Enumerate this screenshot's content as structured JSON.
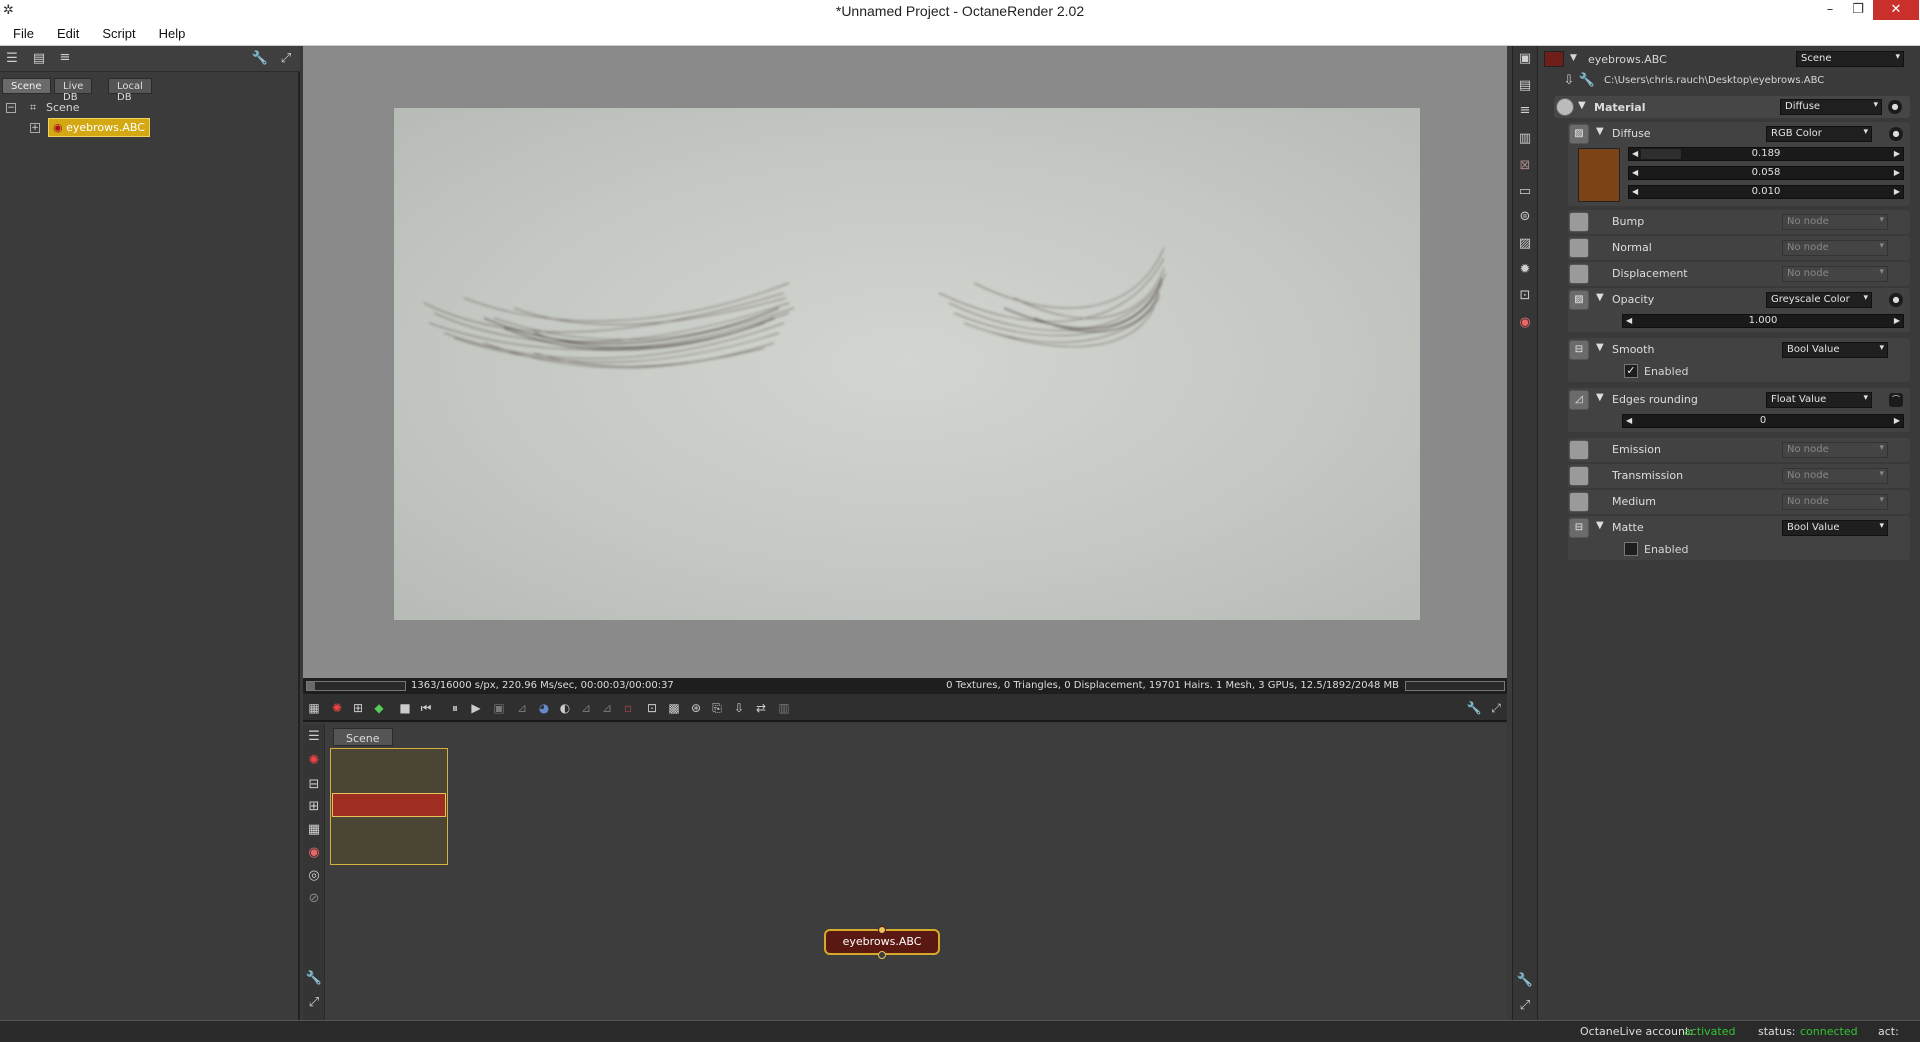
{
  "window": {
    "title": "*Unnamed Project - OctaneRender 2.02",
    "minimize": "–",
    "restore": "❐",
    "close": "✕"
  },
  "menu": [
    "File",
    "Edit",
    "Script",
    "Help"
  ],
  "outliner": {
    "tabs": [
      "Scene",
      "Live DB",
      "Local DB"
    ],
    "active_tab": "Scene",
    "root": "Scene",
    "child": "eyebrows.ABC"
  },
  "viewport": {
    "status_left": "1363/16000 s/px, 220.96 Ms/sec, 00:00:03/00:00:37",
    "status_right": "0 Textures, 0 Triangles, 0 Displacement, 19701 Hairs. 1 Mesh, 3 GPUs, 12.5/1892/2048 MB",
    "progress_fraction": 0.085
  },
  "nodegraph": {
    "tab": "Scene",
    "node_label": "eyebrows.ABC"
  },
  "inspector": {
    "node_name": "eyebrows.ABC",
    "node_type": "Scene",
    "file_path": "C:\\Users\\chris.rauch\\Desktop\\eyebrows.ABC",
    "material": {
      "label": "Material",
      "value": "Diffuse"
    },
    "diffuse": {
      "label": "Diffuse",
      "type": "RGB Color",
      "color": "#7a4418",
      "r": "0.189",
      "g": "0.058",
      "b": "0.010"
    },
    "bump": {
      "label": "Bump",
      "value": "No node"
    },
    "normal": {
      "label": "Normal",
      "value": "No node"
    },
    "displacement": {
      "label": "Displacement",
      "value": "No node"
    },
    "opacity": {
      "label": "Opacity",
      "type": "Greyscale Color",
      "value": "1.000"
    },
    "smooth": {
      "label": "Smooth",
      "type": "Bool Value",
      "check_label": "Enabled",
      "checked": true
    },
    "edges_rounding": {
      "label": "Edges rounding",
      "type": "Float Value",
      "value": "0"
    },
    "emission": {
      "label": "Emission",
      "value": "No node"
    },
    "transmission": {
      "label": "Transmission",
      "value": "No node"
    },
    "medium": {
      "label": "Medium",
      "value": "No node"
    },
    "matte": {
      "label": "Matte",
      "type": "Bool Value",
      "check_label": "Enabled",
      "checked": false
    }
  },
  "statusbar": {
    "account_label": "OctaneLive account:",
    "account_value": "activated",
    "status_label": "status:",
    "status_value": "connected",
    "act_label": "act:"
  },
  "icons": {
    "check": "✓",
    "arrow_left": "◀",
    "arrow_right": "▶",
    "dropdown": "▾",
    "triangle_down": "▼",
    "plus": "+",
    "minus": "−"
  }
}
